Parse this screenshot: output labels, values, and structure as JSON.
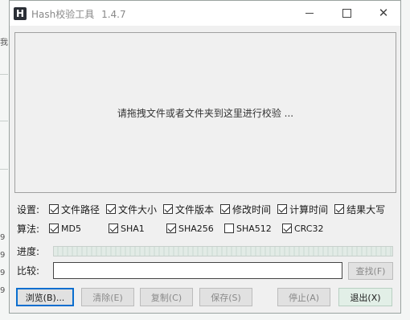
{
  "window": {
    "title": "Hash校验工具",
    "version": "1.4.7",
    "icon": "H"
  },
  "drop_zone": {
    "message": "请拖拽文件或者文件夹到这里进行校验 ..."
  },
  "settings": {
    "label": "设置:",
    "options": [
      {
        "label": "文件路径",
        "checked": true
      },
      {
        "label": "文件大小",
        "checked": true
      },
      {
        "label": "文件版本",
        "checked": true
      },
      {
        "label": "修改时间",
        "checked": true
      },
      {
        "label": "计算时间",
        "checked": true
      },
      {
        "label": "结果大写",
        "checked": true
      }
    ]
  },
  "algorithms": {
    "label": "算法:",
    "options": [
      {
        "label": "MD5",
        "checked": true
      },
      {
        "label": "SHA1",
        "checked": true
      },
      {
        "label": "SHA256",
        "checked": true
      },
      {
        "label": "SHA512",
        "checked": false
      },
      {
        "label": "CRC32",
        "checked": true
      }
    ]
  },
  "progress": {
    "label": "进度:"
  },
  "compare": {
    "label": "比较:",
    "value": "",
    "find_button": "查找(F)"
  },
  "buttons": {
    "browse": "浏览(B)...",
    "clear": "清除(E)",
    "copy": "复制(C)",
    "save": "保存(S)",
    "stop": "停止(A)",
    "exit": "退出(X)"
  },
  "background": {
    "fragments": [
      "我",
      "9",
      "9",
      "9",
      "9"
    ]
  }
}
